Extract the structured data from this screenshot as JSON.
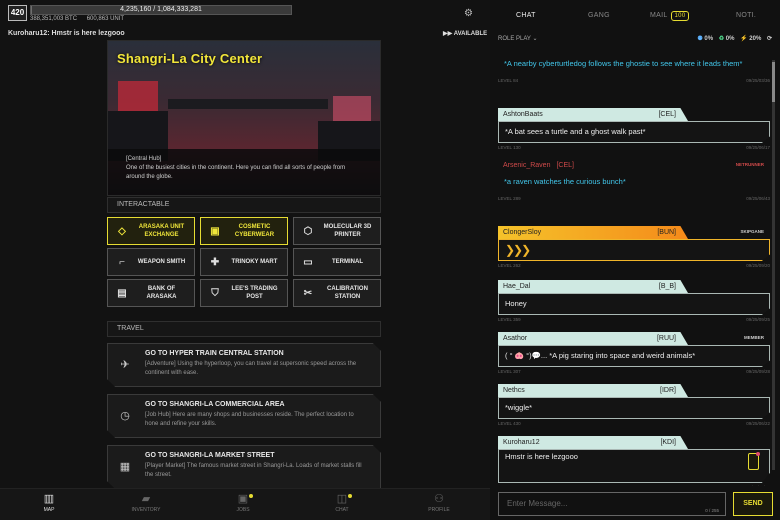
{
  "player": {
    "level": "420",
    "xp_text": "4,235,160 / 1,084,333,281",
    "xp_fraction": 0.004,
    "btc": "388,351,003 BTC",
    "unit": "600,863 UNIT"
  },
  "status": {
    "line": "Kuroharu12: Hmstr is here lezgooo",
    "availability": "AVAILABLE"
  },
  "location": {
    "title": "Shangri-La City Center",
    "tag": "[Central Hub]",
    "description": "One of the busiest cities in the continent. Here you can find all sorts of people from around the globe."
  },
  "interactable": {
    "heading": "INTERACTABLE",
    "buttons": [
      {
        "label": "ARASAKA UNIT EXCHANGE",
        "icon": "diamond-icon",
        "glyph": "◇"
      },
      {
        "label": "COSMETIC CYBERWEAR",
        "icon": "chip-icon",
        "glyph": "▣"
      },
      {
        "label": "MOLECULAR 3D PRINTER",
        "icon": "cube-icon",
        "glyph": "⬡"
      },
      {
        "label": "WEAPON SMITH",
        "icon": "gun-icon",
        "glyph": "⌐"
      },
      {
        "label": "TRINOKY MART",
        "icon": "plus-icon",
        "glyph": "✚"
      },
      {
        "label": "TERMINAL",
        "icon": "terminal-icon",
        "glyph": "▭"
      },
      {
        "label": "BANK OF ARASAKA",
        "icon": "vault-icon",
        "glyph": "▤"
      },
      {
        "label": "LEE'S TRADING POST",
        "icon": "shirt-icon",
        "glyph": "⛉"
      },
      {
        "label": "CALIBRATION STATION",
        "icon": "tools-icon",
        "glyph": "✂"
      }
    ]
  },
  "travel": {
    "heading": "TRAVEL",
    "items": [
      {
        "title": "GO TO HYPER TRAIN CENTRAL STATION",
        "desc": "[Adventure] Using the hyperloop, you can travel at supersonic speed across the continent with ease.",
        "icon": "train-icon",
        "glyph": "✈"
      },
      {
        "title": "GO TO SHANGRI-LA COMMERCIAL AREA",
        "desc": "[Job Hub] Here are many shops and businesses reside. The perfect location to hone and refine your skills.",
        "icon": "clock-icon",
        "glyph": "◷"
      },
      {
        "title": "GO TO SHANGRI-LA MARKET STREET",
        "desc": "[Player Market] The famous market street in Shangri-La. Loads of market stalls fill the street.",
        "icon": "stall-icon",
        "glyph": "▦"
      }
    ]
  },
  "nav": [
    {
      "label": "MAP",
      "icon": "map-icon",
      "glyph": "▥"
    },
    {
      "label": "INVENTORY",
      "icon": "backpack-icon",
      "glyph": "▰"
    },
    {
      "label": "JOBS",
      "icon": "briefcase-icon",
      "glyph": "▣"
    },
    {
      "label": "CHAT",
      "icon": "chat-icon",
      "glyph": "◫"
    },
    {
      "label": "PROFILE",
      "icon": "person-icon",
      "glyph": "⚇"
    }
  ],
  "tabs": {
    "chat": "CHAT",
    "gang": "GANG",
    "mail": "MAIL",
    "mail_count": "100",
    "noti": "NOTI."
  },
  "chat_header": {
    "mode": "ROLE PLAY",
    "stat1": "0%",
    "stat2": "0%",
    "stat3": "20%"
  },
  "messages": [
    {
      "name": "",
      "tag": "",
      "text": "*A nearby cyberturtledog follows the ghostie to see where it leads them*",
      "level": "LEVEL 84",
      "time": "09/25/03/36",
      "style": "cyan",
      "badge": ""
    },
    {
      "name": "AshtonBaats",
      "tag": "[CEL]",
      "text": "*A bat sees a turtle and a ghost walk past*",
      "level": "LEVEL 130",
      "time": "09/25/06/17",
      "style": "normal",
      "badge": ""
    },
    {
      "name": "Arsenic_Raven",
      "tag": "[CEL]",
      "text": "*a raven watches the curious bunch*",
      "level": "LEVEL 289",
      "time": "09/25/06/43",
      "style": "cyanplain",
      "badge": "NETRUNNER"
    },
    {
      "name": "ClongerSloy",
      "tag": "[BUN]",
      "text": "",
      "level": "LEVEL 262",
      "time": "09/25/09/20",
      "style": "gold",
      "badge": "SKIPGANE"
    },
    {
      "name": "Hae_Dal",
      "tag": "[B_B]",
      "text": "Honey",
      "level": "LEVEL 359",
      "time": "09/25/09/25",
      "style": "normal",
      "badge": ""
    },
    {
      "name": "Asathor",
      "tag": "[RUU]",
      "text": "( ° 🐽 °)💬... *A pig staring into space and weird animals*",
      "level": "LEVEL 307",
      "time": "09/25/09/28",
      "style": "normal",
      "badge": "MEMBER"
    },
    {
      "name": "Nethcs",
      "tag": "[IDR]",
      "text": "*wiggle*",
      "level": "LEVEL 430",
      "time": "09/25/06/22",
      "style": "normal",
      "badge": ""
    },
    {
      "name": "Kuroharu12",
      "tag": "[KDI]",
      "text": "Hmstr is here lezgooo",
      "level": "LEVEL 99",
      "time": "09/25/09/31",
      "style": "tall",
      "badge": ""
    }
  ],
  "input": {
    "placeholder": "Enter Message...",
    "count": "0 / 255",
    "send": "SEND"
  }
}
